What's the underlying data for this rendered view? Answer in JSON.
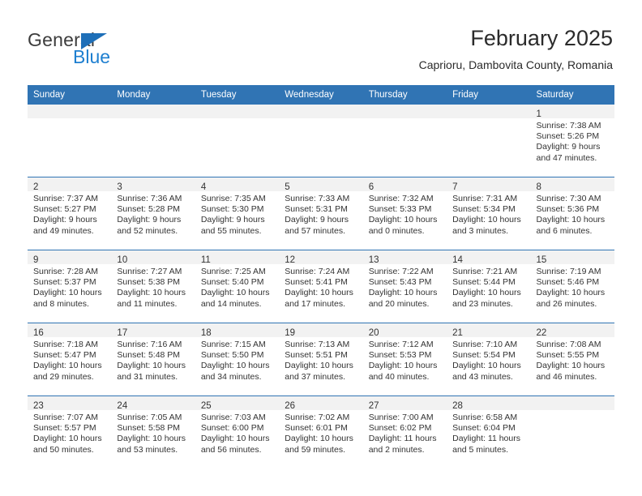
{
  "brand": {
    "name_top": "General",
    "name_bottom": "Blue",
    "triangle_color": "#1e6fb8",
    "blue_text_color": "#1e7fd0"
  },
  "header": {
    "title": "February 2025",
    "subtitle": "Caprioru, Dambovita County, Romania"
  },
  "theme": {
    "header_blue": "#3074b4",
    "daynum_band": "#f2f2f2",
    "text": "#333333"
  },
  "weekday_headers": [
    "Sunday",
    "Monday",
    "Tuesday",
    "Wednesday",
    "Thursday",
    "Friday",
    "Saturday"
  ],
  "labels": {
    "sunrise_prefix": "Sunrise:",
    "sunset_prefix": "Sunset:",
    "daylight_prefix": "Daylight:"
  },
  "weeks": [
    [
      {
        "day": "",
        "empty": true
      },
      {
        "day": "",
        "empty": true
      },
      {
        "day": "",
        "empty": true
      },
      {
        "day": "",
        "empty": true
      },
      {
        "day": "",
        "empty": true
      },
      {
        "day": "",
        "empty": true
      },
      {
        "day": "1",
        "sunrise": "Sunrise: 7:38 AM",
        "sunset": "Sunset: 5:26 PM",
        "daylight": "Daylight: 9 hours and 47 minutes."
      }
    ],
    [
      {
        "day": "2",
        "sunrise": "Sunrise: 7:37 AM",
        "sunset": "Sunset: 5:27 PM",
        "daylight": "Daylight: 9 hours and 49 minutes."
      },
      {
        "day": "3",
        "sunrise": "Sunrise: 7:36 AM",
        "sunset": "Sunset: 5:28 PM",
        "daylight": "Daylight: 9 hours and 52 minutes."
      },
      {
        "day": "4",
        "sunrise": "Sunrise: 7:35 AM",
        "sunset": "Sunset: 5:30 PM",
        "daylight": "Daylight: 9 hours and 55 minutes."
      },
      {
        "day": "5",
        "sunrise": "Sunrise: 7:33 AM",
        "sunset": "Sunset: 5:31 PM",
        "daylight": "Daylight: 9 hours and 57 minutes."
      },
      {
        "day": "6",
        "sunrise": "Sunrise: 7:32 AM",
        "sunset": "Sunset: 5:33 PM",
        "daylight": "Daylight: 10 hours and 0 minutes."
      },
      {
        "day": "7",
        "sunrise": "Sunrise: 7:31 AM",
        "sunset": "Sunset: 5:34 PM",
        "daylight": "Daylight: 10 hours and 3 minutes."
      },
      {
        "day": "8",
        "sunrise": "Sunrise: 7:30 AM",
        "sunset": "Sunset: 5:36 PM",
        "daylight": "Daylight: 10 hours and 6 minutes."
      }
    ],
    [
      {
        "day": "9",
        "sunrise": "Sunrise: 7:28 AM",
        "sunset": "Sunset: 5:37 PM",
        "daylight": "Daylight: 10 hours and 8 minutes."
      },
      {
        "day": "10",
        "sunrise": "Sunrise: 7:27 AM",
        "sunset": "Sunset: 5:38 PM",
        "daylight": "Daylight: 10 hours and 11 minutes."
      },
      {
        "day": "11",
        "sunrise": "Sunrise: 7:25 AM",
        "sunset": "Sunset: 5:40 PM",
        "daylight": "Daylight: 10 hours and 14 minutes."
      },
      {
        "day": "12",
        "sunrise": "Sunrise: 7:24 AM",
        "sunset": "Sunset: 5:41 PM",
        "daylight": "Daylight: 10 hours and 17 minutes."
      },
      {
        "day": "13",
        "sunrise": "Sunrise: 7:22 AM",
        "sunset": "Sunset: 5:43 PM",
        "daylight": "Daylight: 10 hours and 20 minutes."
      },
      {
        "day": "14",
        "sunrise": "Sunrise: 7:21 AM",
        "sunset": "Sunset: 5:44 PM",
        "daylight": "Daylight: 10 hours and 23 minutes."
      },
      {
        "day": "15",
        "sunrise": "Sunrise: 7:19 AM",
        "sunset": "Sunset: 5:46 PM",
        "daylight": "Daylight: 10 hours and 26 minutes."
      }
    ],
    [
      {
        "day": "16",
        "sunrise": "Sunrise: 7:18 AM",
        "sunset": "Sunset: 5:47 PM",
        "daylight": "Daylight: 10 hours and 29 minutes."
      },
      {
        "day": "17",
        "sunrise": "Sunrise: 7:16 AM",
        "sunset": "Sunset: 5:48 PM",
        "daylight": "Daylight: 10 hours and 31 minutes."
      },
      {
        "day": "18",
        "sunrise": "Sunrise: 7:15 AM",
        "sunset": "Sunset: 5:50 PM",
        "daylight": "Daylight: 10 hours and 34 minutes."
      },
      {
        "day": "19",
        "sunrise": "Sunrise: 7:13 AM",
        "sunset": "Sunset: 5:51 PM",
        "daylight": "Daylight: 10 hours and 37 minutes."
      },
      {
        "day": "20",
        "sunrise": "Sunrise: 7:12 AM",
        "sunset": "Sunset: 5:53 PM",
        "daylight": "Daylight: 10 hours and 40 minutes."
      },
      {
        "day": "21",
        "sunrise": "Sunrise: 7:10 AM",
        "sunset": "Sunset: 5:54 PM",
        "daylight": "Daylight: 10 hours and 43 minutes."
      },
      {
        "day": "22",
        "sunrise": "Sunrise: 7:08 AM",
        "sunset": "Sunset: 5:55 PM",
        "daylight": "Daylight: 10 hours and 46 minutes."
      }
    ],
    [
      {
        "day": "23",
        "sunrise": "Sunrise: 7:07 AM",
        "sunset": "Sunset: 5:57 PM",
        "daylight": "Daylight: 10 hours and 50 minutes."
      },
      {
        "day": "24",
        "sunrise": "Sunrise: 7:05 AM",
        "sunset": "Sunset: 5:58 PM",
        "daylight": "Daylight: 10 hours and 53 minutes."
      },
      {
        "day": "25",
        "sunrise": "Sunrise: 7:03 AM",
        "sunset": "Sunset: 6:00 PM",
        "daylight": "Daylight: 10 hours and 56 minutes."
      },
      {
        "day": "26",
        "sunrise": "Sunrise: 7:02 AM",
        "sunset": "Sunset: 6:01 PM",
        "daylight": "Daylight: 10 hours and 59 minutes."
      },
      {
        "day": "27",
        "sunrise": "Sunrise: 7:00 AM",
        "sunset": "Sunset: 6:02 PM",
        "daylight": "Daylight: 11 hours and 2 minutes."
      },
      {
        "day": "28",
        "sunrise": "Sunrise: 6:58 AM",
        "sunset": "Sunset: 6:04 PM",
        "daylight": "Daylight: 11 hours and 5 minutes."
      },
      {
        "day": "",
        "empty": true
      }
    ]
  ]
}
